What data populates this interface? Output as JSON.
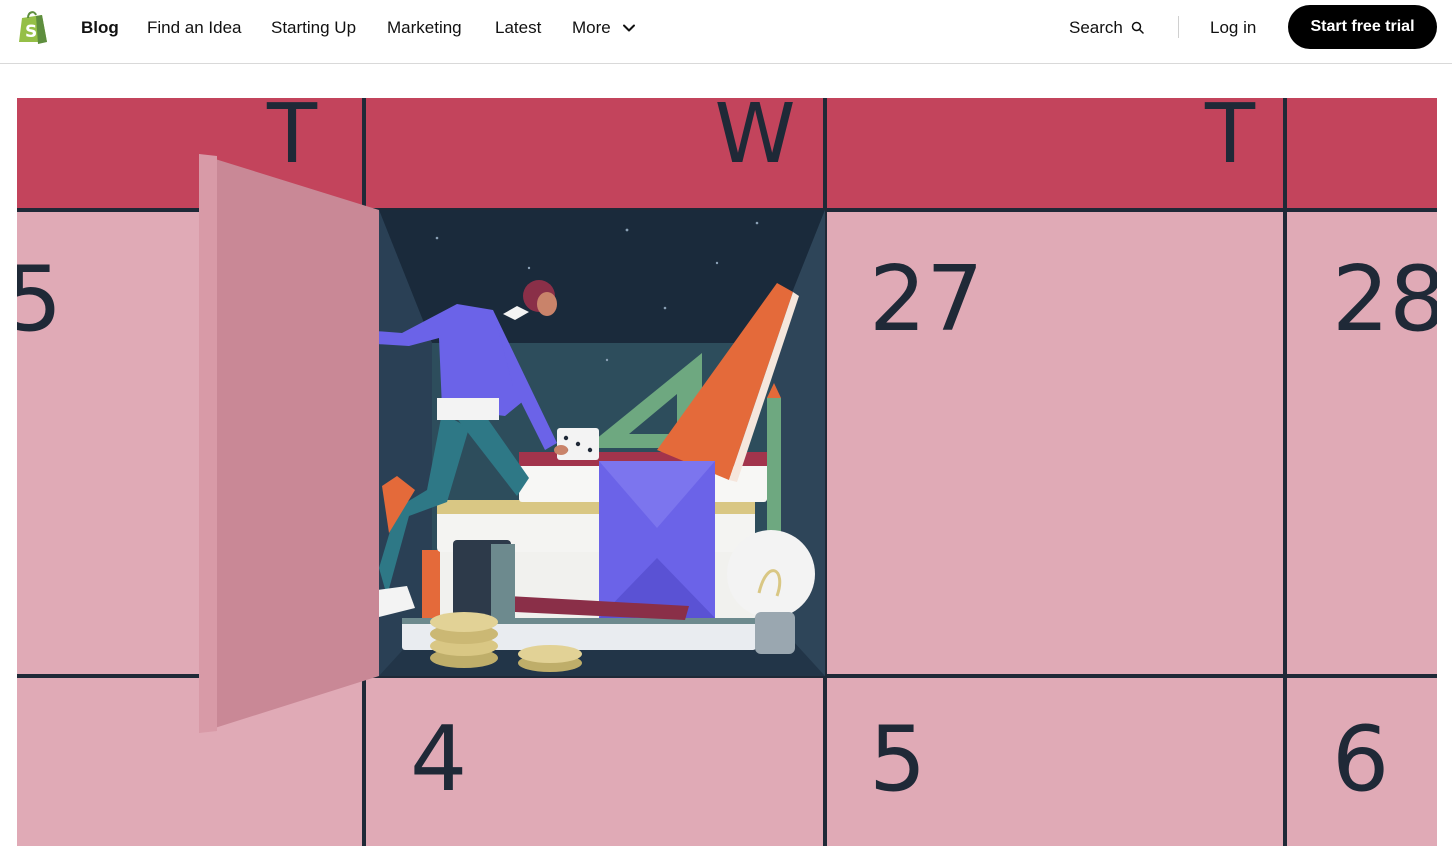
{
  "nav": {
    "items": [
      {
        "label": "Blog"
      },
      {
        "label": "Find an Idea"
      },
      {
        "label": "Starting Up"
      },
      {
        "label": "Marketing"
      },
      {
        "label": "Latest"
      },
      {
        "label": "More"
      }
    ],
    "search_label": "Search",
    "login_label": "Log in",
    "cta_label": "Start free trial"
  },
  "hero": {
    "day_headers": [
      "T",
      "W",
      "T"
    ],
    "dates": [
      "5",
      "27",
      "28",
      "4",
      "5",
      "6"
    ],
    "colors": {
      "header": "#c3445c",
      "cell": "#e0aab6",
      "grid_line": "#1f2937",
      "box_interior": "#223548",
      "door": "#c98896",
      "sweater": "#6b63e8",
      "orange_book": "#e46a3a"
    }
  },
  "icons": [
    "shopify-bag-icon",
    "chevron-down-icon",
    "search-icon"
  ]
}
